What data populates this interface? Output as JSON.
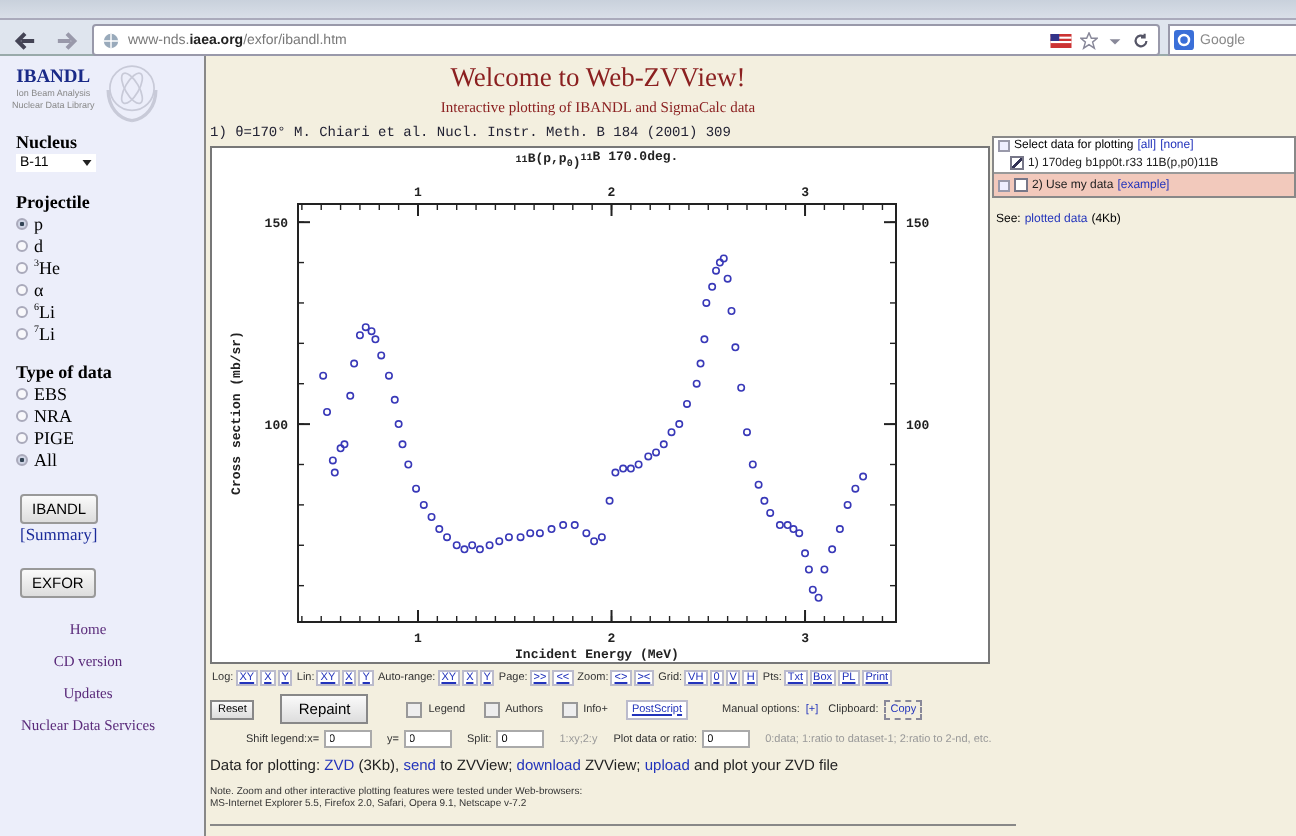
{
  "browser": {
    "url": "www-nds.**iaea.org**/exfor/ibandl.htm",
    "search_placeholder": "Google"
  },
  "sidebar": {
    "logo_title": "IBANDL",
    "logo_lines": [
      "Ion Beam Analysis",
      "Nuclear Data Library"
    ],
    "nucleus_label": "Nucleus",
    "nucleus_value": "B-11",
    "projectile_label": "Projectile",
    "projectiles": [
      {
        "label": "p",
        "selected": true
      },
      {
        "label": "d",
        "selected": false
      },
      {
        "label": "$^{3}$He",
        "selected": false
      },
      {
        "label": "α",
        "selected": false
      },
      {
        "label": "$^{6}$Li",
        "selected": false
      },
      {
        "label": "$^{7}$Li",
        "selected": false
      }
    ],
    "type_label": "Type of data",
    "types": [
      {
        "label": "EBS",
        "selected": false
      },
      {
        "label": "NRA",
        "selected": false
      },
      {
        "label": "PIGE",
        "selected": false
      },
      {
        "label": "All",
        "selected": true
      }
    ],
    "ibandl_button": "IBANDL",
    "summary_link": "[Summary]",
    "exfor_button": "EXFOR",
    "links": [
      "Home",
      "CD version",
      "Updates",
      "Nuclear Data Services"
    ]
  },
  "header": {
    "title": "Welcome to Web-ZVView!",
    "subtitle": "Interactive plotting of IBANDL and SigmaCalc data",
    "reference": "1) θ=170° M. Chiari et al. Nucl. Instr. Meth. B 184 (2001) 309"
  },
  "plot": {
    "top_axis_labels": [
      "1",
      "2",
      "3"
    ],
    "right_axis_labels": [
      "150",
      "100"
    ],
    "chart_data": {
      "type": "scatter",
      "title": "$^{11}$B(p,p$_{0}$)$^{11}$B 170.0deg.",
      "xlabel": "Incident Energy (MeV)",
      "ylabel": "Cross section (mb/sr)",
      "xlim": [
        0.38,
        3.47
      ],
      "ylim": [
        51,
        154.5
      ],
      "xticks": [
        {
          "value": 1,
          "label": "1"
        },
        {
          "value": 2,
          "label": "2"
        },
        {
          "value": 3,
          "label": "3"
        }
      ],
      "yticks": [
        {
          "value": 100,
          "label": "100"
        },
        {
          "value": 150,
          "label": "150"
        }
      ],
      "x": [
        0.51,
        0.53,
        0.56,
        0.57,
        0.6,
        0.62,
        0.65,
        0.67,
        0.7,
        0.73,
        0.76,
        0.78,
        0.81,
        0.85,
        0.88,
        0.9,
        0.92,
        0.95,
        0.99,
        1.03,
        1.07,
        1.11,
        1.15,
        1.2,
        1.24,
        1.28,
        1.32,
        1.37,
        1.42,
        1.47,
        1.53,
        1.58,
        1.63,
        1.69,
        1.75,
        1.81,
        1.87,
        1.91,
        1.95,
        1.99,
        2.02,
        2.06,
        2.1,
        2.14,
        2.19,
        2.23,
        2.27,
        2.31,
        2.35,
        2.39,
        2.44,
        2.46,
        2.48,
        2.49,
        2.52,
        2.54,
        2.56,
        2.58,
        2.6,
        2.62,
        2.64,
        2.67,
        2.7,
        2.73,
        2.76,
        2.79,
        2.82,
        2.87,
        2.91,
        2.94,
        2.97,
        3.0,
        3.02,
        3.04,
        3.07,
        3.1,
        3.14,
        3.18,
        3.22,
        3.26,
        3.3
      ],
      "series": [
        {
          "color": "#3838b8",
          "values": [
            112,
            103,
            91,
            88,
            94,
            95,
            107,
            115,
            122,
            124,
            123,
            121,
            117,
            112,
            106,
            100,
            95,
            90,
            84,
            80,
            77,
            74,
            72,
            70,
            69,
            70,
            69,
            70,
            71,
            72,
            72,
            73,
            73,
            74,
            75,
            75,
            73,
            71,
            72,
            81,
            88,
            89,
            89,
            90,
            92,
            93,
            95,
            98,
            100,
            105,
            110,
            115,
            121,
            130,
            134,
            138,
            140,
            141,
            136,
            128,
            119,
            109,
            98,
            90,
            85,
            81,
            78,
            75,
            75,
            74,
            73,
            68,
            64,
            59,
            57,
            64,
            69,
            74,
            80,
            84,
            87
          ]
        }
      ]
    }
  },
  "datasets": {
    "header": "Select data for plotting",
    "all_link": "[all]",
    "none_link": "[none]",
    "items": [
      {
        "kind": "dataset",
        "label": "1) 170deg b1pp0t.r33 11B(p,p0)11B",
        "checked": true
      },
      {
        "kind": "user",
        "label": "2) Use my data",
        "link": "[example]",
        "checked": false
      }
    ],
    "see_label": "See:",
    "see_link": "plotted data",
    "see_size": "(4Kb)"
  },
  "controls": {
    "range_groups": [
      {
        "label": "Log:",
        "links": [
          "XY",
          "X",
          "Y"
        ]
      },
      {
        "label": "Lin:",
        "links": [
          "XY",
          "X",
          "Y"
        ]
      },
      {
        "label": "Auto-range:",
        "links": [
          "XY",
          "X",
          "Y"
        ]
      },
      {
        "label": "Page:",
        "links": [
          ">>",
          "<<"
        ]
      },
      {
        "label": "Zoom:",
        "links": [
          "<>",
          "><"
        ]
      },
      {
        "label": "Grid:",
        "links": [
          "VH",
          "0",
          "V",
          "H"
        ]
      },
      {
        "label": "Pts:",
        "links": [
          "Txt",
          "Box",
          "PL",
          "Print"
        ]
      }
    ],
    "reset": "Reset",
    "repaint": "Repaint",
    "options": [
      {
        "label": "Legend",
        "checked": false
      },
      {
        "label": "Authors",
        "checked": false
      },
      {
        "label": "Info+",
        "checked": false
      }
    ],
    "postscript": "PostScript",
    "manual_label": "Manual options:",
    "manual_link": "[+]",
    "clipboard_label": "Clipboard:",
    "copy": "Copy",
    "fields": [
      {
        "label": "Shift legend:x=",
        "value": "0"
      },
      {
        "label": "y=",
        "value": "0"
      },
      {
        "label": "Split:",
        "value": "0",
        "hint": "1:xy;2:y"
      },
      {
        "label": "Plot data or ratio:",
        "value": "0",
        "hint": "0:data; 1:ratio to dataset-1; 2:ratio to 2-nd, etc."
      }
    ],
    "data_line": [
      {
        "kind": "text",
        "text": "Data for plotting: "
      },
      {
        "kind": "link",
        "text": "ZVD"
      },
      {
        "kind": "text",
        "text": " (3Kb), "
      },
      {
        "kind": "link",
        "text": "send"
      },
      {
        "kind": "text",
        "text": " to ZVView; "
      },
      {
        "kind": "link",
        "text": "download"
      },
      {
        "kind": "text",
        "text": " ZVView; "
      },
      {
        "kind": "link",
        "text": "upload"
      },
      {
        "kind": "text",
        "text": " and plot your ZVD file"
      }
    ],
    "note": [
      "Note. Zoom and other interactive plotting features were tested under Web-browsers:",
      "MS-Internet Explorer 5.5, Firefox 2.0, Safari, Opera 9.1, Netscape v-7.2"
    ]
  }
}
